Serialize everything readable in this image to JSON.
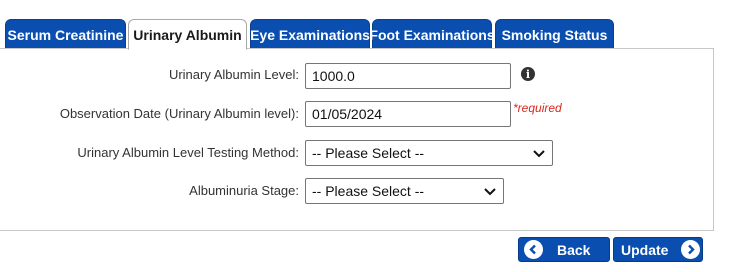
{
  "tabs": [
    {
      "label": "Serum Creatinine",
      "active": false
    },
    {
      "label": "Urinary Albumin",
      "active": true
    },
    {
      "label": "Eye Examinations",
      "active": false
    },
    {
      "label": "Foot Examinations",
      "active": false
    },
    {
      "label": "Smoking Status",
      "active": false
    }
  ],
  "form": {
    "level_label": "Urinary Albumin Level:",
    "level_value": "1000.0",
    "info_icon": "info-icon",
    "date_label": "Observation Date (Urinary Albumin level):",
    "date_value": "01/05/2024",
    "required_text": "*required",
    "method_label": "Urinary Albumin Level Testing Method:",
    "method_value": "-- Please Select --",
    "stage_label": "Albuminuria Stage:",
    "stage_value": "-- Please Select --"
  },
  "buttons": {
    "back_label": "Back",
    "update_label": "Update"
  },
  "colors": {
    "tab_blue": "#0a4fb0",
    "required_red": "#d9281c"
  }
}
